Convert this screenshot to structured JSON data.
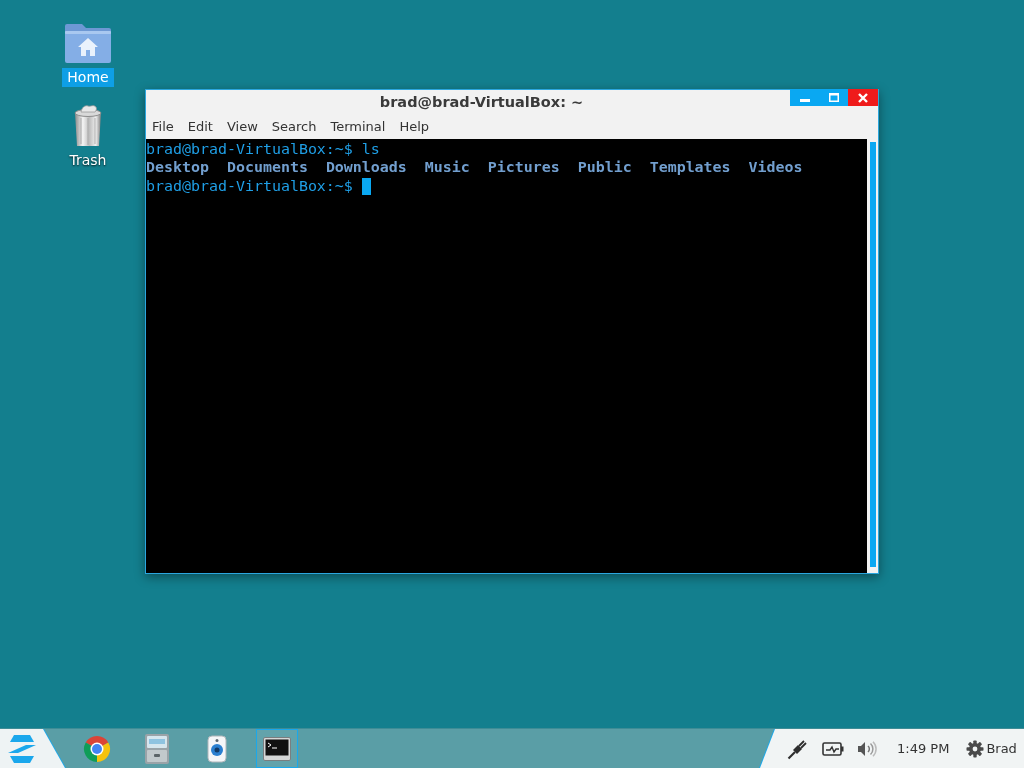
{
  "desktop": {
    "icons": [
      {
        "kind": "home-folder",
        "label": "Home",
        "selected": true
      },
      {
        "kind": "trash",
        "label": "Trash",
        "selected": false
      }
    ]
  },
  "window": {
    "title": "brad@brad-VirtualBox: ~",
    "menu": [
      "File",
      "Edit",
      "View",
      "Search",
      "Terminal",
      "Help"
    ],
    "terminal": {
      "lines": [
        {
          "kind": "command",
          "text": "brad@brad-VirtualBox:~$ ls",
          "cursor": false
        },
        {
          "kind": "listing",
          "items": [
            "Desktop",
            "Documents",
            "Downloads",
            "Music",
            "Pictures",
            "Public",
            "Templates",
            "Videos"
          ]
        },
        {
          "kind": "command",
          "text": "brad@brad-VirtualBox:~$",
          "cursor": true
        }
      ]
    }
  },
  "taskbar": {
    "launchers": [
      {
        "kind": "browser",
        "active": false
      },
      {
        "kind": "file-cabinet",
        "active": false
      },
      {
        "kind": "speaker",
        "active": false
      },
      {
        "kind": "terminal",
        "active": true
      }
    ],
    "tray": {
      "clock": "1:49 PM",
      "user": "Brad"
    }
  }
}
